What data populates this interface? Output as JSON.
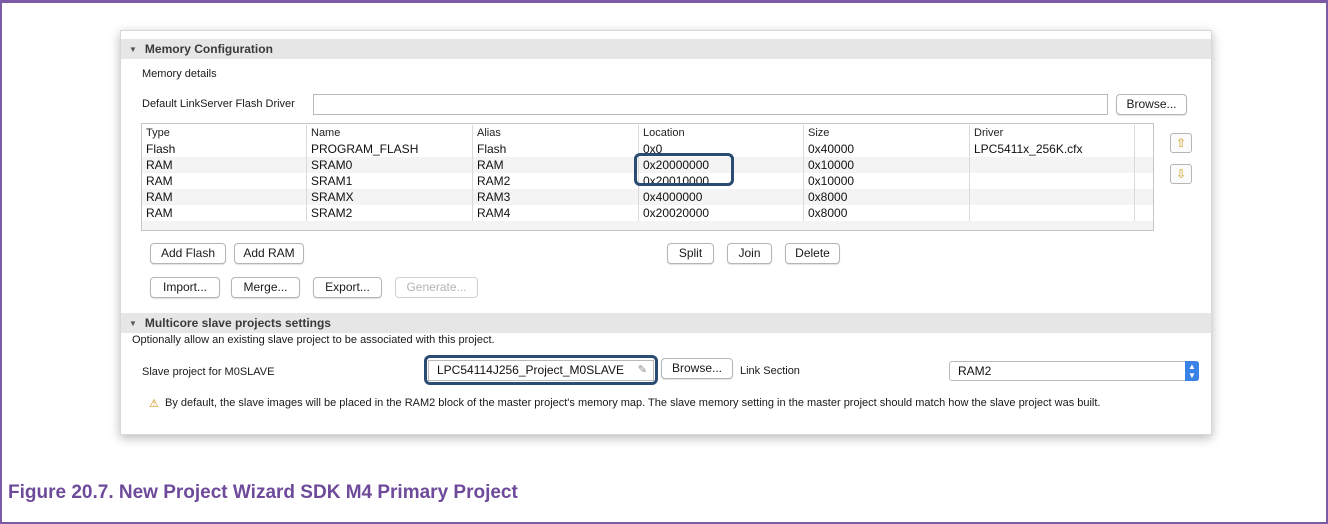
{
  "caption": "Figure 20.7. New Project Wizard SDK M4 Primary Project",
  "memory_section": {
    "title": "Memory Configuration",
    "details_label": "Memory details",
    "flash_driver_label": "Default LinkServer Flash Driver",
    "flash_driver_value": "",
    "browse_label": "Browse...",
    "columns": [
      "Type",
      "Name",
      "Alias",
      "Location",
      "Size",
      "Driver"
    ],
    "rows": [
      [
        "Flash",
        "PROGRAM_FLASH",
        "Flash",
        "0x0",
        "0x40000",
        "LPC5411x_256K.cfx"
      ],
      [
        "RAM",
        "SRAM0",
        "RAM",
        "0x20000000",
        "0x10000",
        ""
      ],
      [
        "RAM",
        "SRAM1",
        "RAM2",
        "0x20010000",
        "0x10000",
        ""
      ],
      [
        "RAM",
        "SRAMX",
        "RAM3",
        "0x4000000",
        "0x8000",
        ""
      ],
      [
        "RAM",
        "SRAM2",
        "RAM4",
        "0x20020000",
        "0x8000",
        ""
      ]
    ],
    "buttons": {
      "add_flash": "Add Flash",
      "add_ram": "Add RAM",
      "split": "Split",
      "join": "Join",
      "delete": "Delete",
      "import": "Import...",
      "merge": "Merge...",
      "export": "Export...",
      "generate": "Generate..."
    },
    "side_icons": [
      "move-up-icon",
      "move-down-icon"
    ]
  },
  "multicore_section": {
    "title": "Multicore slave projects settings",
    "description": "Optionally allow an existing slave project to be associated with this project.",
    "slave_label": "Slave project for M0SLAVE",
    "slave_value": "LPC54114J256_Project_M0SLAVE",
    "browse_label": "Browse...",
    "link_section_label": "Link Section",
    "link_section_value": "RAM2",
    "warning_icon": "warning-icon",
    "warning_text": "By default, the slave images will be placed in the RAM2 block of the master project's memory map. The slave memory setting in the master project should match how the slave project was built."
  },
  "colors": {
    "frame_border": "#7c5aa6",
    "caption": "#6e4a9a",
    "highlight": "#2a4b72",
    "combo_accent": "#3b82e6"
  }
}
